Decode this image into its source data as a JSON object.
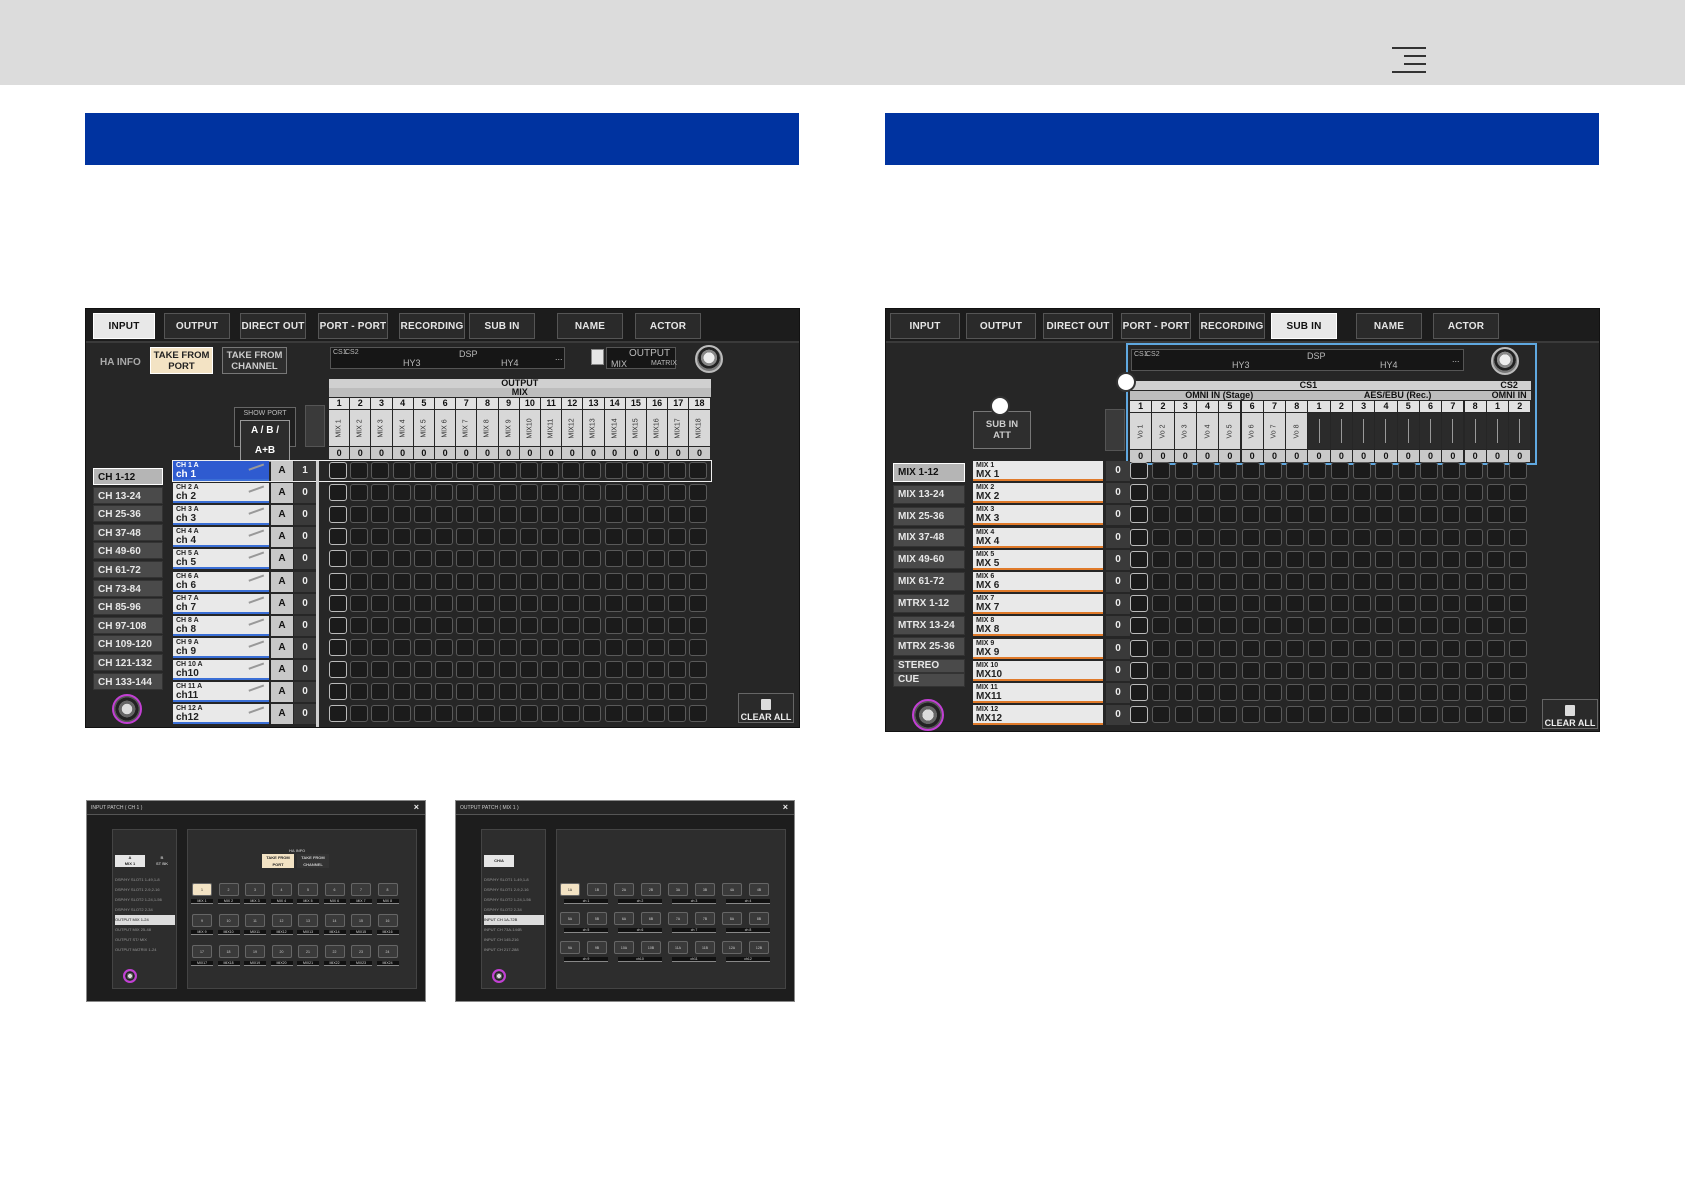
{
  "left_screen": {
    "tabs": [
      "INPUT",
      "OUTPUT",
      "DIRECT OUT",
      "PORT - PORT",
      "RECORDING",
      "SUB IN",
      "NAME",
      "ACTOR"
    ],
    "active_tab": "INPUT",
    "ha_info": "HA INFO",
    "take_from_port": [
      "TAKE FROM",
      "PORT"
    ],
    "take_from_channel": [
      "TAKE FROM",
      "CHANNEL"
    ],
    "dsp": {
      "cs1": "CS1",
      "cs2": "CS2",
      "dsp": "DSP",
      "hy3": "HY3",
      "hy4": "HY4",
      "dots": "...",
      "output": "OUTPUT",
      "mix": "MIX",
      "matrix": "MATRIX"
    },
    "show_port": {
      "title": "SHOW PORT",
      "value": "A / B / A+B"
    },
    "header_output": "OUTPUT",
    "header_mix": "MIX",
    "column_numbers": [
      "1",
      "2",
      "3",
      "4",
      "5",
      "6",
      "7",
      "8",
      "9",
      "10",
      "11",
      "12",
      "13",
      "14",
      "15",
      "16",
      "17",
      "18"
    ],
    "column_names": [
      "MIX 1",
      "MIX 2",
      "MIX 3",
      "MIX 4",
      "MIX 5",
      "MIX 6",
      "MIX 7",
      "MIX 8",
      "MIX 9",
      "MIX10",
      "MIX11",
      "MIX12",
      "MIX13",
      "MIX14",
      "MIX15",
      "MIX16",
      "MIX17",
      "MIX18"
    ],
    "column_values": [
      "0",
      "0",
      "0",
      "0",
      "0",
      "0",
      "0",
      "0",
      "0",
      "0",
      "0",
      "0",
      "0",
      "0",
      "0",
      "0",
      "0",
      "0"
    ],
    "groups": [
      "CH 1-12",
      "CH 13-24",
      "CH 25-36",
      "CH 37-48",
      "CH 49-60",
      "CH 61-72",
      "CH 73-84",
      "CH 85-96",
      "CH 97-108",
      "CH 109-120",
      "CH 121-132",
      "CH 133-144"
    ],
    "active_group": "CH 1-12",
    "rows": [
      {
        "port": "CH 1 A",
        "name": "ch 1",
        "ab": "A",
        "val": "1"
      },
      {
        "port": "CH 2 A",
        "name": "ch 2",
        "ab": "A",
        "val": "0"
      },
      {
        "port": "CH 3 A",
        "name": "ch 3",
        "ab": "A",
        "val": "0"
      },
      {
        "port": "CH 4 A",
        "name": "ch 4",
        "ab": "A",
        "val": "0"
      },
      {
        "port": "CH 5 A",
        "name": "ch 5",
        "ab": "A",
        "val": "0"
      },
      {
        "port": "CH 6 A",
        "name": "ch 6",
        "ab": "A",
        "val": "0"
      },
      {
        "port": "CH 7 A",
        "name": "ch 7",
        "ab": "A",
        "val": "0"
      },
      {
        "port": "CH 8 A",
        "name": "ch 8",
        "ab": "A",
        "val": "0"
      },
      {
        "port": "CH 9 A",
        "name": "ch 9",
        "ab": "A",
        "val": "0"
      },
      {
        "port": "CH 10 A",
        "name": "ch10",
        "ab": "A",
        "val": "0"
      },
      {
        "port": "CH 11 A",
        "name": "ch11",
        "ab": "A",
        "val": "0"
      },
      {
        "port": "CH 12 A",
        "name": "ch12",
        "ab": "A",
        "val": "0"
      }
    ],
    "clear_all": "CLEAR ALL"
  },
  "right_screen": {
    "tabs": [
      "INPUT",
      "OUTPUT",
      "DIRECT OUT",
      "PORT - PORT",
      "RECORDING",
      "SUB IN",
      "NAME",
      "ACTOR"
    ],
    "active_tab": "SUB IN",
    "sub_in_att": [
      "SUB IN",
      "ATT"
    ],
    "dsp": {
      "cs1": "CS1",
      "cs2": "CS2",
      "dsp": "DSP",
      "hy3": "HY3",
      "hy4": "HY4",
      "dots": "..."
    },
    "header_cs1": "CS1",
    "header_cs2": "CS2",
    "header_omni_stage": "OMNI IN (Stage)",
    "header_aes": "AES/EBU (Rec.)",
    "header_omni_in": "OMNI IN",
    "column_numbers": [
      "1",
      "2",
      "3",
      "4",
      "5",
      "6",
      "7",
      "8",
      "1",
      "2",
      "3",
      "4",
      "5",
      "6",
      "7",
      "8",
      "1",
      "2"
    ],
    "column_names": [
      "Vo 1",
      "Vo 2",
      "Vo 3",
      "Vo 4",
      "Vo 5",
      "Vo 6",
      "Vo 7",
      "Vo 8",
      "",
      "",
      "",
      "",
      "",
      "",
      "",
      "",
      "",
      ""
    ],
    "column_values": [
      "0",
      "0",
      "0",
      "0",
      "0",
      "0",
      "0",
      "0",
      "0",
      "0",
      "0",
      "0",
      "0",
      "0",
      "0",
      "0",
      "0",
      "0"
    ],
    "groups": [
      "MIX 1-12",
      "MIX 13-24",
      "MIX 25-36",
      "MIX 37-48",
      "MIX 49-60",
      "MIX 61-72",
      "MTRX 1-12",
      "MTRX 13-24",
      "MTRX 25-36",
      "STEREO",
      "CUE"
    ],
    "active_group": "MIX 1-12",
    "rows": [
      {
        "port": "MIX 1",
        "name": "MX 1",
        "val": "0"
      },
      {
        "port": "MIX 2",
        "name": "MX 2",
        "val": "0"
      },
      {
        "port": "MIX 3",
        "name": "MX 3",
        "val": "0"
      },
      {
        "port": "MIX 4",
        "name": "MX 4",
        "val": "0"
      },
      {
        "port": "MIX 5",
        "name": "MX 5",
        "val": "0"
      },
      {
        "port": "MIX 6",
        "name": "MX 6",
        "val": "0"
      },
      {
        "port": "MIX 7",
        "name": "MX 7",
        "val": "0"
      },
      {
        "port": "MIX 8",
        "name": "MX 8",
        "val": "0"
      },
      {
        "port": "MIX 9",
        "name": "MX 9",
        "val": "0"
      },
      {
        "port": "MIX 10",
        "name": "MX10",
        "val": "0"
      },
      {
        "port": "MIX 11",
        "name": "MX11",
        "val": "0"
      },
      {
        "port": "MIX 12",
        "name": "MX12",
        "val": "0"
      }
    ],
    "clear_all": "CLEAR ALL"
  },
  "thumb_input": {
    "title": "INPUT PATCH ( CH 1 )",
    "close": "×",
    "tab_a": [
      "A",
      "MIX 1"
    ],
    "tab_b": [
      "B",
      "ST BK"
    ],
    "list": [
      "DSP/HY SLOT1 1-49,1-8",
      "DSP/HY SLOT1 2-9,2-16",
      "DSP/HY SLOT2 1-24,1-56",
      "DSP/HY SLOT2 2-34",
      "OUTPUT MIX 1-24",
      "OUTPUT MIX 25-48",
      "OUTPUT ST/ MIX",
      "OUTPUT MATRIX 1-24"
    ],
    "active_item": "OUTPUT MIX 1-24",
    "ha_info": "HA INFO",
    "take_port": [
      "TAKE FROM",
      "PORT"
    ],
    "take_channel": [
      "TAKE FROM",
      "CHANNEL"
    ],
    "buttons": [
      "1",
      "2",
      "3",
      "4",
      "5",
      "6",
      "7",
      "8",
      "9",
      "10",
      "11",
      "12",
      "13",
      "14",
      "15",
      "16",
      "17",
      "18",
      "19",
      "20",
      "21",
      "22",
      "23",
      "24"
    ],
    "labels": [
      "MIX 1",
      "MIX 2",
      "MIX 3",
      "MIX 4",
      "MIX 5",
      "MIX 6",
      "MIX 7",
      "MIX 8",
      "MIX 9",
      "MIX10",
      "MIX11",
      "MIX12",
      "MIX13",
      "MIX14",
      "MIX15",
      "MIX16",
      "MIX17",
      "MIX18",
      "MIX19",
      "MIX20",
      "MIX21",
      "MIX22",
      "MIX23",
      "MIX24"
    ]
  },
  "thumb_output": {
    "title": "OUTPUT PATCH ( MIX 1 )",
    "close": "×",
    "tab": "CH/A",
    "list": [
      "DSP/HY SLOT1 1-49,1-8",
      "DSP/HY SLOT1 2-9,2-16",
      "DSP/HY SLOT2 1-24,1-56",
      "DSP/HY SLOT2 2-34",
      "INPUT CH 1A-72B",
      "INPUT CH 73A-144B",
      "INPUT CH 145-216",
      "INPUT CH 217-288"
    ],
    "active_item": "INPUT CH 1A-72B",
    "buttons": [
      "1A",
      "1B",
      "2A",
      "2B",
      "3A",
      "3B",
      "4A",
      "4B",
      "5A",
      "5B",
      "6A",
      "6B",
      "7A",
      "7B",
      "8A",
      "8B",
      "9A",
      "9B",
      "10A",
      "10B",
      "11A",
      "11B",
      "12A",
      "12B"
    ],
    "labels": [
      "ch 1",
      "ch 2",
      "ch 3",
      "ch 4",
      "ch 5",
      "ch 6",
      "ch 7",
      "ch 8",
      "ch 9",
      "ch10",
      "ch11",
      "ch12"
    ]
  }
}
